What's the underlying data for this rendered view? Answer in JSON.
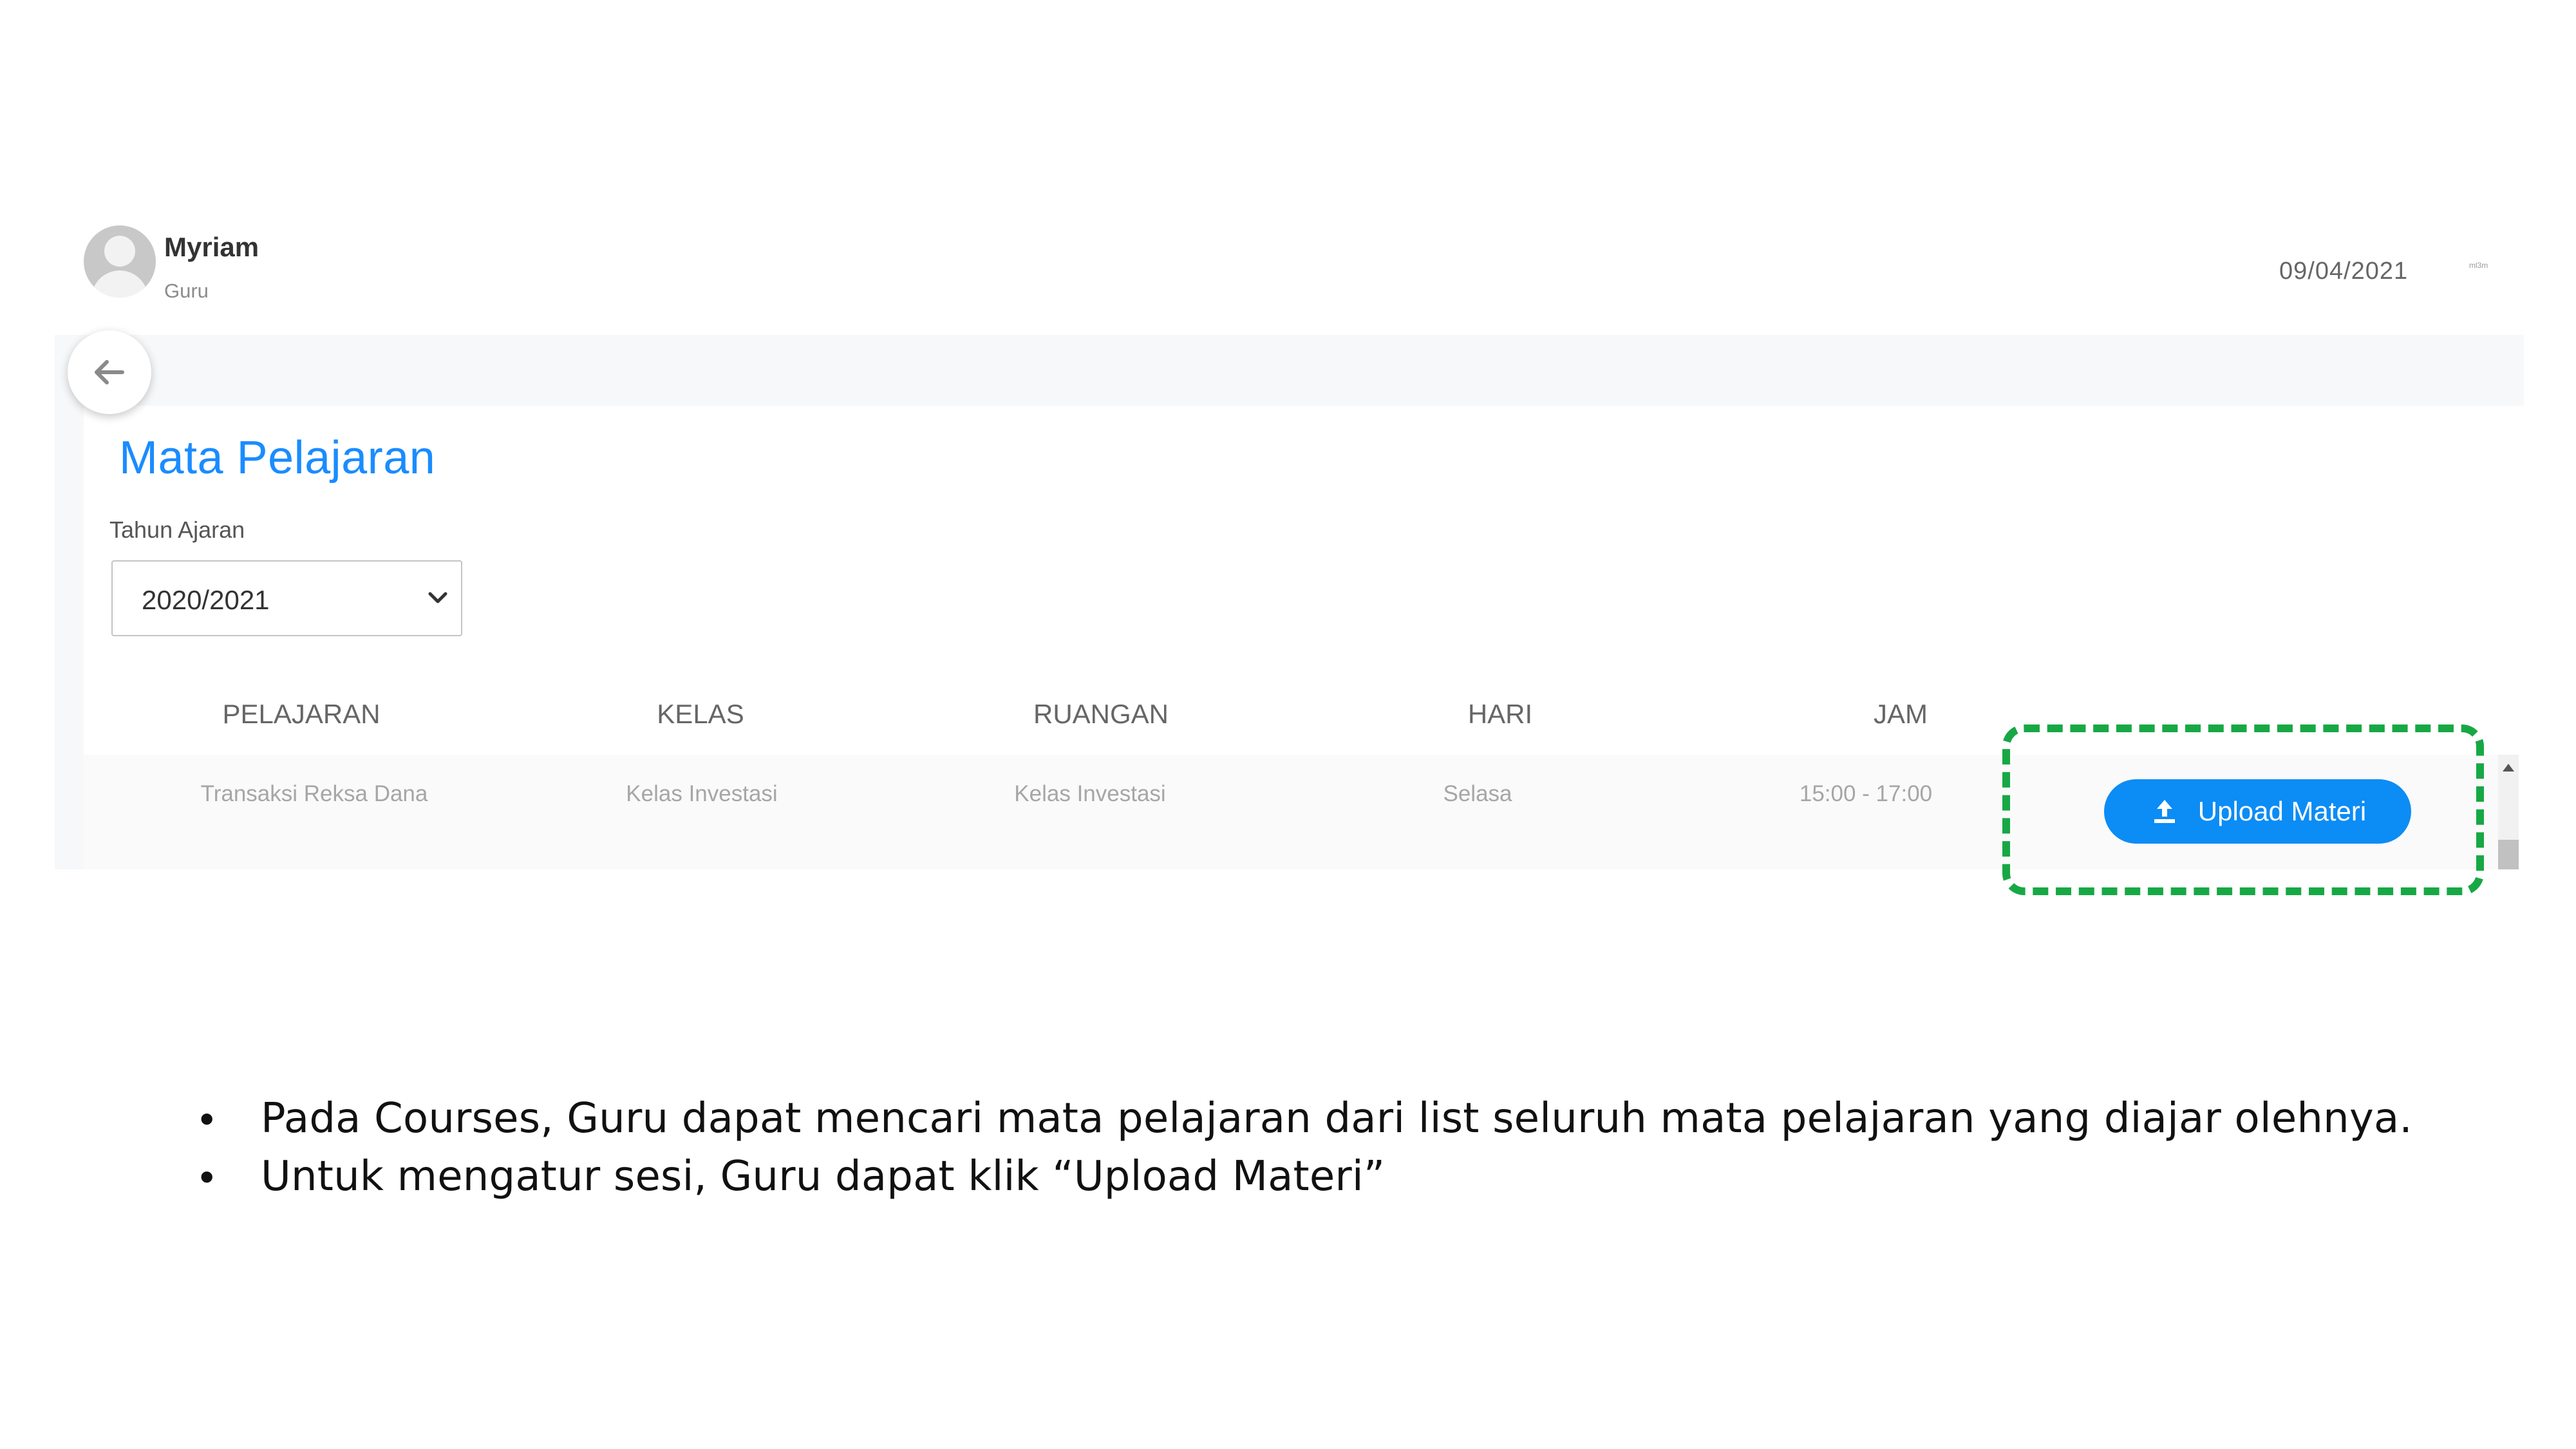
{
  "header": {
    "user_name": "Myriam",
    "user_role": "Guru",
    "date": "09/04/2021",
    "status_text": "ml3m"
  },
  "page": {
    "title": "Mata Pelajaran",
    "year_label": "Tahun Ajaran",
    "year_selected": "2020/2021"
  },
  "table": {
    "columns": [
      "PELAJARAN",
      "KELAS",
      "RUANGAN",
      "HARI",
      "JAM"
    ],
    "rows": [
      {
        "pelajaran": "Transaksi Reksa Dana",
        "kelas": "Kelas Investasi",
        "ruangan": "Kelas Investasi",
        "hari": "Selasa",
        "jam": "15:00 - 17:00",
        "action_label": "Upload Materi"
      }
    ]
  },
  "notes": [
    "Pada Courses, Guru dapat mencari mata pelajaran dari list seluruh mata pelajaran yang diajar olehnya.",
    "Untuk mengatur sesi, Guru dapat klik “Upload Materi”"
  ],
  "colors": {
    "accent": "#1a8cff",
    "button": "#0c8cf5",
    "highlight": "#17a845"
  },
  "icons": {
    "back": "arrow-left-icon",
    "upload": "upload-icon",
    "select": "chevron-down-icon",
    "avatar": "user-avatar-icon"
  }
}
